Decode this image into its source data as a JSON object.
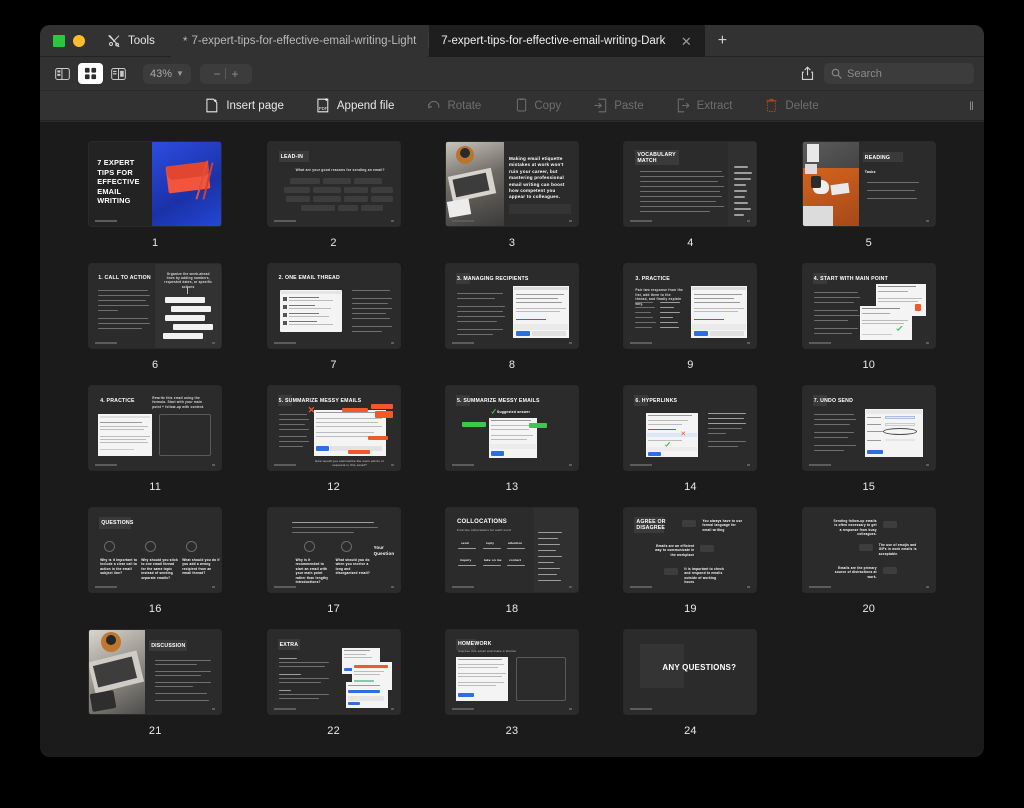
{
  "window": {
    "tools_label": "Tools",
    "tabs": [
      {
        "label": "7-expert-tips-for-effective-email-writing-Light",
        "modified_dot": "*",
        "active": false
      },
      {
        "label": "7-expert-tips-for-effective-email-writing-Dark",
        "modified_dot": "",
        "active": true
      }
    ],
    "new_tab_label": "+"
  },
  "toolbar": {
    "sidebar_icon": "sidebar-icon",
    "grid_icon": "grid-view-icon",
    "split_icon": "split-view-icon",
    "zoom_level": "43%",
    "zoom_caret": "⌄",
    "zoom_out": "−",
    "zoom_in": "+",
    "share_icon": "share-icon",
    "search_icon": "search-icon",
    "search_placeholder": "Search",
    "search_value": ""
  },
  "actions": [
    {
      "label": "Insert page",
      "icon": "insert-page-icon",
      "disabled": false
    },
    {
      "label": "Append file",
      "icon": "append-file-icon",
      "disabled": false
    },
    {
      "label": "Rotate",
      "icon": "rotate-icon",
      "disabled": true
    },
    {
      "label": "Copy",
      "icon": "copy-icon",
      "disabled": true
    },
    {
      "label": "Paste",
      "icon": "paste-icon",
      "disabled": true
    },
    {
      "label": "Extract",
      "icon": "extract-icon",
      "disabled": true
    },
    {
      "label": "Delete",
      "icon": "delete-icon",
      "disabled": true
    }
  ],
  "overflow_label": "‖",
  "pages": [
    {
      "number": "1",
      "title": "7 EXPERT TIPS FOR EFFECTIVE EMAIL WRITING",
      "kind": "cover"
    },
    {
      "number": "2",
      "title": "LEAD-IN",
      "subtitle": "What are your good reasons for sending an email?",
      "kind": "chips"
    },
    {
      "number": "3",
      "title": "",
      "body": "Making email etiquette mistakes at work won't ruin your career, but mastering professional email writing can boost how competent you appear to colleagues.",
      "kind": "photo-text"
    },
    {
      "number": "4",
      "title": "VOCABULARY MATCH",
      "kind": "vocab"
    },
    {
      "number": "5",
      "title": "READING",
      "subtitle": "Tasks",
      "kind": "photo-tasks"
    },
    {
      "number": "6",
      "title": "1. CALL TO ACTION",
      "kind": "flow"
    },
    {
      "number": "7",
      "title": "2. ONE EMAIL THREAD",
      "kind": "mail-left"
    },
    {
      "number": "8",
      "title": "3. MANAGING RECIPIENTS",
      "kind": "mail-right"
    },
    {
      "number": "9",
      "title": "3. PRACTICE",
      "kind": "mail-right-list"
    },
    {
      "number": "10",
      "title": "4. START WITH MAIN POINT",
      "kind": "two-mail"
    },
    {
      "number": "11",
      "title": "4. PRACTICE",
      "kind": "doc-box"
    },
    {
      "number": "12",
      "title": "5. SUMMARIZE MESSY EMAILS",
      "kind": "annot-orange"
    },
    {
      "number": "13",
      "title": "5. SUMMARIZE MESSY EMAILS",
      "subtitle": "Suggested answer",
      "kind": "annot-green"
    },
    {
      "number": "14",
      "title": "6. HYPERLINKS",
      "kind": "mail-left-text"
    },
    {
      "number": "15",
      "title": "7. UNDO SEND",
      "kind": "settings"
    },
    {
      "number": "16",
      "title": "QUESTIONS",
      "kind": "questions3"
    },
    {
      "number": "17",
      "title": "",
      "kind": "questions2",
      "note": "Your Question"
    },
    {
      "number": "18",
      "title": "COLLOCATIONS",
      "subtitle": "Find two collocations for each word",
      "kind": "collocations"
    },
    {
      "number": "19",
      "title": "AGREE OR DISAGREE",
      "kind": "agree"
    },
    {
      "number": "20",
      "title": "",
      "kind": "agree2"
    },
    {
      "number": "21",
      "title": "DISCUSSION",
      "kind": "photo-list"
    },
    {
      "number": "22",
      "title": "EXTRA",
      "kind": "extra"
    },
    {
      "number": "23",
      "title": "HOMEWORK",
      "subtitle": "Improve this email and make it shorter",
      "kind": "homework"
    },
    {
      "number": "24",
      "title": "ANY QUESTIONS?",
      "kind": "final"
    }
  ],
  "colors": {
    "window_chrome": "#323232",
    "active_tab": "#1e1e1e",
    "page_area": "#1b1b1b",
    "thumb": "#2b2b2b",
    "accent_orange": "#f05a28",
    "accent_blue": "#2d6fe0",
    "traffic_red": "#ff5f57",
    "traffic_yellow": "#febc2e",
    "traffic_green": "#28c840"
  }
}
